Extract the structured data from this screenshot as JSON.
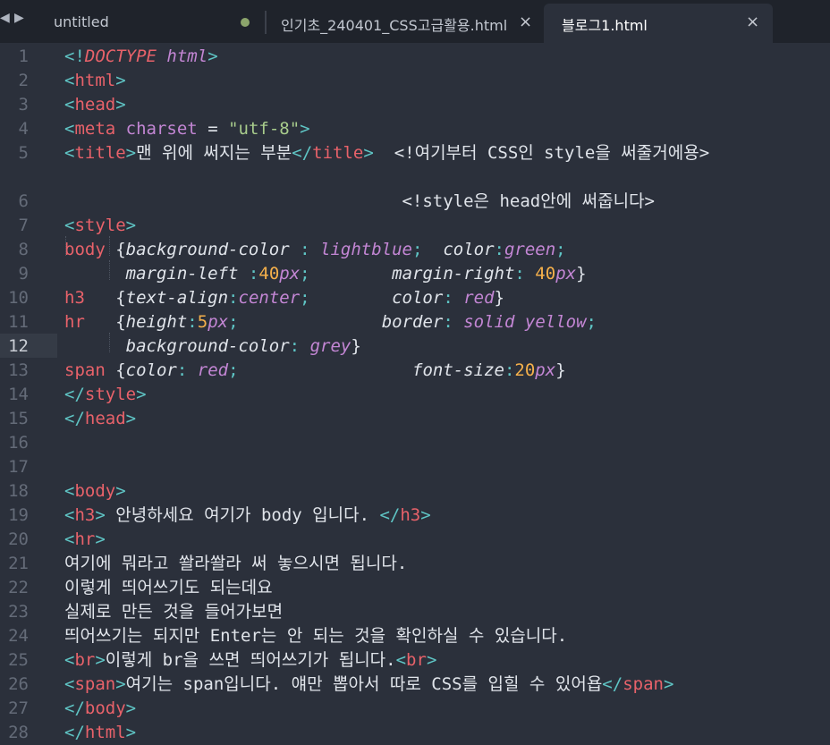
{
  "window": {
    "nav_back": "◀",
    "nav_forward": "▶",
    "tabs": [
      {
        "label": "untitled",
        "modified": true,
        "active": false
      },
      {
        "label": "인기초_240401_CSS고급활용.html",
        "close": "×",
        "active": false
      },
      {
        "label": "블로그1.html",
        "close": "×",
        "active": true
      }
    ]
  },
  "colors": {
    "background": "#2b303b",
    "tag": "#e8626a",
    "punct": "#5fc5c5",
    "string": "#a8cc8c",
    "number": "#f5b04b",
    "keyword": "#c386d4",
    "text": "#e0e4ea"
  },
  "editor": {
    "current_line": "12",
    "lines": [
      {
        "n": "1",
        "segments": [
          [
            "<!",
            "p"
          ],
          [
            "DOCTYPE",
            "tagi"
          ],
          [
            " ",
            "t"
          ],
          [
            "html",
            "kw"
          ],
          [
            ">",
            "p"
          ]
        ]
      },
      {
        "n": "2",
        "segments": [
          [
            "<",
            "p"
          ],
          [
            "html",
            "tag"
          ],
          [
            ">",
            "p"
          ]
        ]
      },
      {
        "n": "3",
        "segments": [
          [
            "<",
            "p"
          ],
          [
            "head",
            "tag"
          ],
          [
            ">",
            "p"
          ]
        ]
      },
      {
        "n": "4",
        "segments": [
          [
            "<",
            "p"
          ],
          [
            "meta",
            "tag"
          ],
          [
            " ",
            "t"
          ],
          [
            "charset",
            "attr"
          ],
          [
            " = ",
            "t"
          ],
          [
            "\"utf-8\"",
            "str"
          ],
          [
            ">",
            "p"
          ]
        ]
      },
      {
        "n": "5",
        "segments": [
          [
            "<",
            "p"
          ],
          [
            "title",
            "tag"
          ],
          [
            ">",
            "p"
          ],
          [
            "맨 위에 써지는 부분",
            "t"
          ],
          [
            "</",
            "p"
          ],
          [
            "title",
            "tag"
          ],
          [
            ">",
            "p"
          ],
          [
            "  <!여기부터 CSS인 style을 써줄거에용>",
            "t"
          ]
        ]
      },
      {
        "n": "",
        "segments": []
      },
      {
        "n": "6",
        "segments": [
          [
            "                                 <!style은 head안에 써줍니다>",
            "t"
          ]
        ]
      },
      {
        "n": "7",
        "segments": [
          [
            "<",
            "p"
          ],
          [
            "style",
            "tag"
          ],
          [
            ">",
            "p"
          ]
        ]
      },
      {
        "n": "8",
        "segments": [
          [
            "body",
            "tag"
          ],
          [
            " {",
            "t"
          ],
          [
            "background-color",
            "prop"
          ],
          [
            " : ",
            "p"
          ],
          [
            "lightblue",
            "kw"
          ],
          [
            ";",
            "p"
          ],
          [
            "  ",
            "t"
          ],
          [
            "color",
            "prop"
          ],
          [
            ":",
            "p"
          ],
          [
            "green",
            "kw"
          ],
          [
            ";",
            "p"
          ]
        ]
      },
      {
        "n": "9",
        "segments": [
          [
            "      ",
            "t"
          ],
          [
            "margin-left",
            "prop"
          ],
          [
            " :",
            "p"
          ],
          [
            "40",
            "num"
          ],
          [
            "px",
            "kw"
          ],
          [
            ";",
            "p"
          ],
          [
            "        ",
            "t"
          ],
          [
            "margin-right",
            "prop"
          ],
          [
            ": ",
            "p"
          ],
          [
            "40",
            "num"
          ],
          [
            "px",
            "kw"
          ],
          [
            "}",
            "t"
          ]
        ]
      },
      {
        "n": "10",
        "segments": [
          [
            "h3",
            "tag"
          ],
          [
            "   {",
            "t"
          ],
          [
            "text-align",
            "prop"
          ],
          [
            ":",
            "p"
          ],
          [
            "center",
            "kw"
          ],
          [
            ";",
            "p"
          ],
          [
            "        ",
            "t"
          ],
          [
            "color",
            "prop"
          ],
          [
            ": ",
            "p"
          ],
          [
            "red",
            "kw"
          ],
          [
            "}",
            "t"
          ]
        ]
      },
      {
        "n": "11",
        "segments": [
          [
            "hr",
            "tag"
          ],
          [
            "   {",
            "t"
          ],
          [
            "height",
            "prop"
          ],
          [
            ":",
            "p"
          ],
          [
            "5",
            "num"
          ],
          [
            "px",
            "kw"
          ],
          [
            ";",
            "p"
          ],
          [
            "              ",
            "t"
          ],
          [
            "border",
            "prop"
          ],
          [
            ": ",
            "p"
          ],
          [
            "solid",
            "kw"
          ],
          [
            " ",
            "t"
          ],
          [
            "yellow",
            "kw"
          ],
          [
            ";",
            "p"
          ]
        ]
      },
      {
        "n": "12",
        "segments": [
          [
            "      ",
            "t"
          ],
          [
            "background-color",
            "prop"
          ],
          [
            ": ",
            "p"
          ],
          [
            "grey",
            "kw"
          ],
          [
            "}",
            "t"
          ]
        ]
      },
      {
        "n": "13",
        "segments": [
          [
            "span",
            "tag"
          ],
          [
            " {",
            "t"
          ],
          [
            "color",
            "prop"
          ],
          [
            ": ",
            "p"
          ],
          [
            "red",
            "kw"
          ],
          [
            ";",
            "p"
          ],
          [
            "                 ",
            "t"
          ],
          [
            "font-size",
            "prop"
          ],
          [
            ":",
            "p"
          ],
          [
            "20",
            "num"
          ],
          [
            "px",
            "kw"
          ],
          [
            "}",
            "t"
          ]
        ]
      },
      {
        "n": "14",
        "segments": [
          [
            "</",
            "p"
          ],
          [
            "style",
            "tag"
          ],
          [
            ">",
            "p"
          ]
        ]
      },
      {
        "n": "15",
        "segments": [
          [
            "</",
            "p"
          ],
          [
            "head",
            "tag"
          ],
          [
            ">",
            "p"
          ]
        ]
      },
      {
        "n": "16",
        "segments": []
      },
      {
        "n": "17",
        "segments": []
      },
      {
        "n": "18",
        "segments": [
          [
            "<",
            "p"
          ],
          [
            "body",
            "tag"
          ],
          [
            ">",
            "p"
          ]
        ]
      },
      {
        "n": "19",
        "segments": [
          [
            "<",
            "p"
          ],
          [
            "h3",
            "tag"
          ],
          [
            ">",
            "p"
          ],
          [
            " 안녕하세요 여기가 body 입니다. ",
            "t"
          ],
          [
            "</",
            "p"
          ],
          [
            "h3",
            "tag"
          ],
          [
            ">",
            "p"
          ]
        ]
      },
      {
        "n": "20",
        "segments": [
          [
            "<",
            "p"
          ],
          [
            "hr",
            "tag"
          ],
          [
            ">",
            "p"
          ]
        ]
      },
      {
        "n": "21",
        "segments": [
          [
            "여기에 뭐라고 쏼라쏼라 써 놓으시면 됩니다.",
            "t"
          ]
        ]
      },
      {
        "n": "22",
        "segments": [
          [
            "이렇게 띄어쓰기도 되는데요",
            "t"
          ]
        ]
      },
      {
        "n": "23",
        "segments": [
          [
            "실제로 만든 것을 들어가보면",
            "t"
          ]
        ]
      },
      {
        "n": "24",
        "segments": [
          [
            "띄어쓰기는 되지만 Enter는 안 되는 것을 확인하실 수 있습니다.",
            "t"
          ]
        ]
      },
      {
        "n": "25",
        "segments": [
          [
            "<",
            "p"
          ],
          [
            "br",
            "tag"
          ],
          [
            ">",
            "p"
          ],
          [
            "이렇게 br을 쓰면 띄어쓰기가 됩니다.",
            "t"
          ],
          [
            "<",
            "p"
          ],
          [
            "br",
            "tag"
          ],
          [
            ">",
            "p"
          ]
        ]
      },
      {
        "n": "26",
        "segments": [
          [
            "<",
            "p"
          ],
          [
            "span",
            "tag"
          ],
          [
            ">",
            "p"
          ],
          [
            "여기는 span입니다. 얘만 뽑아서 따로 CSS를 입힐 수 있어욥",
            "t"
          ],
          [
            "</",
            "p"
          ],
          [
            "span",
            "tag"
          ],
          [
            ">",
            "p"
          ]
        ]
      },
      {
        "n": "27",
        "segments": [
          [
            "</",
            "p"
          ],
          [
            "body",
            "tag"
          ],
          [
            ">",
            "p"
          ]
        ]
      },
      {
        "n": "28",
        "segments": [
          [
            "</",
            "p"
          ],
          [
            "html",
            "tag"
          ],
          [
            ">",
            "p"
          ]
        ]
      }
    ]
  }
}
